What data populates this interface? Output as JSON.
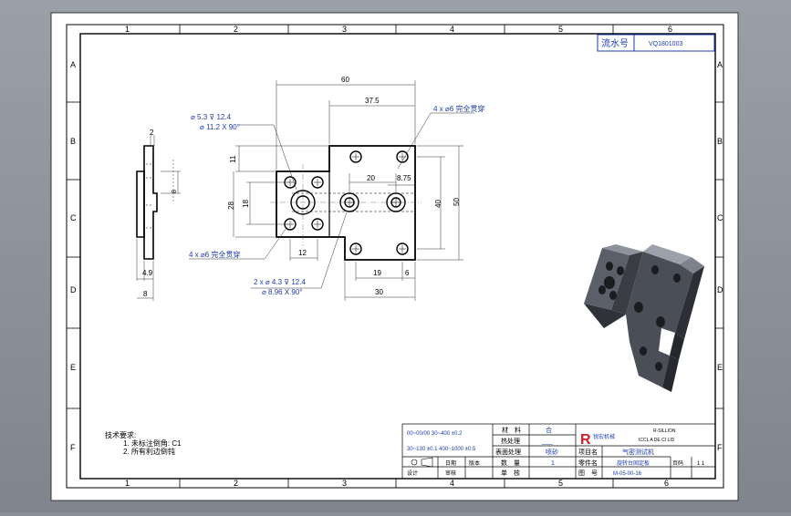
{
  "header": {
    "serial_label": "流水号",
    "serial_value": "VQ1801003"
  },
  "border": {
    "columns": [
      "1",
      "2",
      "3",
      "4",
      "5",
      "6"
    ],
    "rows": [
      "A",
      "B",
      "C",
      "D",
      "E",
      "F"
    ]
  },
  "dimensions": {
    "overall_width": "60",
    "top_width": "37.5",
    "height_50": "50",
    "height_40": "40",
    "h_20": "20",
    "h_875": "8.75",
    "h_11": "11",
    "h_28": "28",
    "h_18": "18",
    "h_12": "12",
    "b_19": "19",
    "b_6": "6",
    "b_30": "30",
    "side_2": "2",
    "side_8v": "8",
    "side_49": "4.9",
    "side_8": "8"
  },
  "callouts": {
    "counterbore_1": "⌀ 5.3 ⊽ 12.4",
    "counterbore_2": "⌀ 11.2 X 90°",
    "holes_top": "4 x ⌀6 完全贯穿",
    "holes_left": "4 x ⌀6 完全贯穿",
    "csk_1": "2 x ⌀ 4.3 ⊽ 12.4",
    "csk_2": "⌀ 8.96 X 90°"
  },
  "notes": {
    "title": "技术要求:",
    "line1": "1. 未标注倒角: C1",
    "line2": "2. 所有利边倒钝"
  },
  "title_block": {
    "material_label": "材　料",
    "material_value": "合",
    "heat_label": "热处理",
    "heat_value": "___",
    "surface_label": "表面处理",
    "surface_value": "喷砂",
    "qty_label": "数　量",
    "qty_value": "1",
    "scale_label": "单　核",
    "part_label": "零件名",
    "part_value": "旋转台固定板",
    "drawing_label": "图　号",
    "drawing_value": "M-05-00-16",
    "machine_label": "项目名",
    "machine_value": "气密测试机",
    "company_name": "R-SILLION",
    "company_sub": "ICCL A DE CI LID",
    "logo_text": "R",
    "logo_name": "锐宏机械",
    "date_label": "日期",
    "rev_label": "版本",
    "sheet_label": "页码",
    "sheet_value": "1 1",
    "design_label": "设计",
    "check_label": "审核",
    "tol1": "00~00/00  30~400 ±0.2",
    "tol2": "30~130 ±0.1  400~1000 ±0.5"
  }
}
